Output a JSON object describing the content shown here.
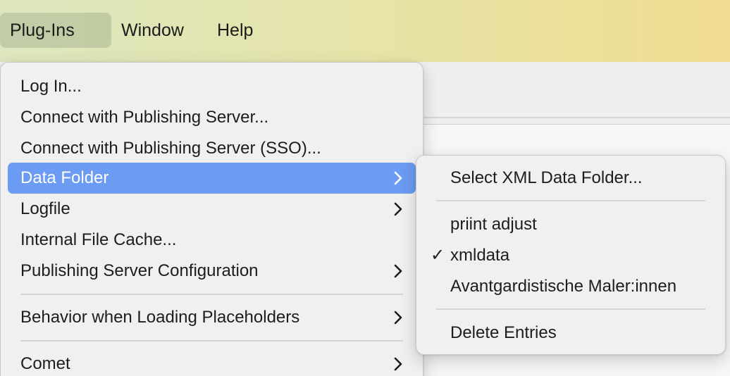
{
  "menubar": {
    "items": [
      {
        "label": "Plug-Ins",
        "active": true
      },
      {
        "label": "Window",
        "active": false
      },
      {
        "label": "Help",
        "active": false
      }
    ]
  },
  "main_menu": {
    "items": [
      {
        "label": "Log In...",
        "submenu": false
      },
      {
        "label": "Connect with Publishing Server...",
        "submenu": false
      },
      {
        "label": "Connect with Publishing Server (SSO)...",
        "submenu": false
      },
      {
        "label": "Data Folder",
        "submenu": true,
        "highlighted": true
      },
      {
        "label": "Logfile",
        "submenu": true
      },
      {
        "label": "Internal File Cache...",
        "submenu": false
      },
      {
        "label": "Publishing Server Configuration",
        "submenu": true
      },
      {
        "label": "Behavior when Loading Placeholders",
        "submenu": true
      },
      {
        "label": "Comet",
        "submenu": true
      }
    ]
  },
  "sub_menu": {
    "items": [
      {
        "label": "Select XML Data Folder...",
        "checked": false
      },
      {
        "label": "priint adjust",
        "checked": false
      },
      {
        "label": "xmldata",
        "checked": true
      },
      {
        "label": "Avantgardistische Maler:innen",
        "checked": false
      },
      {
        "label": "Delete Entries",
        "checked": false
      }
    ],
    "check_glyph": "✓"
  },
  "colors": {
    "highlight": "#6b9bf2",
    "menubar_gradient_start": "#dde6bf",
    "menubar_gradient_end": "#f0dc90"
  }
}
